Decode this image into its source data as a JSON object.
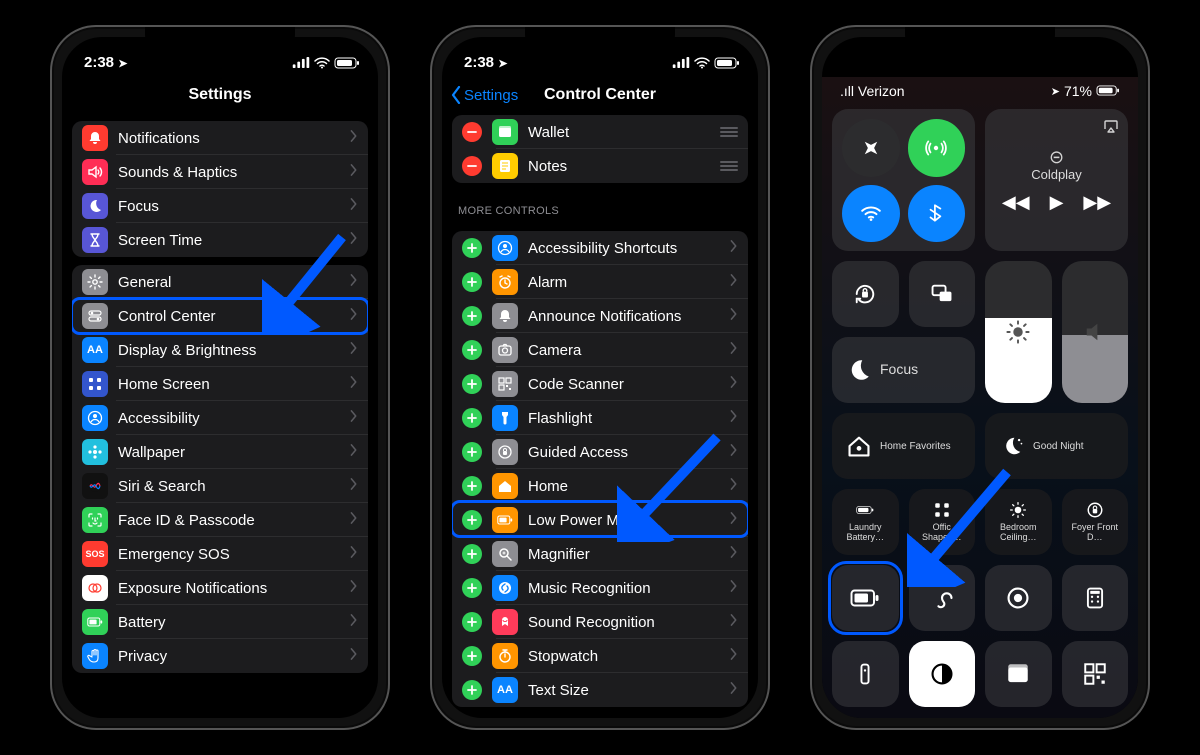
{
  "phone1": {
    "status": {
      "time": "2:38",
      "location_glyph": "➤"
    },
    "nav_title": "Settings",
    "group_a": [
      {
        "label": "Notifications",
        "icon": "bell",
        "bg": "#ff3b30"
      },
      {
        "label": "Sounds & Haptics",
        "icon": "speaker",
        "bg": "#ff2d55"
      },
      {
        "label": "Focus",
        "icon": "moon",
        "bg": "#5856d6"
      },
      {
        "label": "Screen Time",
        "icon": "hourglass",
        "bg": "#5856d6"
      }
    ],
    "group_b": [
      {
        "label": "General",
        "icon": "gear",
        "bg": "#8e8e93"
      },
      {
        "label": "Control Center",
        "icon": "switches",
        "bg": "#8e8e93"
      },
      {
        "label": "Display & Brightness",
        "icon": "AA",
        "bg": "#0a84ff"
      },
      {
        "label": "Home Screen",
        "icon": "grid",
        "bg": "#3355cc"
      },
      {
        "label": "Accessibility",
        "icon": "person",
        "bg": "#0a84ff"
      },
      {
        "label": "Wallpaper",
        "icon": "flower",
        "bg": "#22c0de"
      },
      {
        "label": "Siri & Search",
        "icon": "siri",
        "bg": "#111"
      },
      {
        "label": "Face ID & Passcode",
        "icon": "faceid",
        "bg": "#30d158"
      },
      {
        "label": "Emergency SOS",
        "icon": "SOS",
        "bg": "#ff3b30"
      },
      {
        "label": "Exposure Notifications",
        "icon": "exposure",
        "bg": "#fff"
      },
      {
        "label": "Battery",
        "icon": "battery",
        "bg": "#30d158"
      },
      {
        "label": "Privacy",
        "icon": "hand",
        "bg": "#0a84ff"
      }
    ]
  },
  "phone2": {
    "status": {
      "time": "2:38",
      "location_glyph": "➤"
    },
    "nav_back": "Settings",
    "nav_title": "Control Center",
    "included": [
      {
        "label": "Wallet",
        "icon": "wallet",
        "bg": "#30d158",
        "lead": "del"
      },
      {
        "label": "Notes",
        "icon": "notes",
        "bg": "#ffcc00",
        "lead": "del"
      }
    ],
    "more_header": "MORE CONTROLS",
    "more": [
      {
        "label": "Accessibility Shortcuts",
        "icon": "person",
        "bg": "#0a84ff"
      },
      {
        "label": "Alarm",
        "icon": "alarm",
        "bg": "#ff9500"
      },
      {
        "label": "Announce Notifications",
        "icon": "bell",
        "bg": "#8e8e93"
      },
      {
        "label": "Camera",
        "icon": "camera",
        "bg": "#8e8e93"
      },
      {
        "label": "Code Scanner",
        "icon": "qr",
        "bg": "#8e8e93"
      },
      {
        "label": "Flashlight",
        "icon": "flashlight",
        "bg": "#0a84ff"
      },
      {
        "label": "Guided Access",
        "icon": "lockring",
        "bg": "#8e8e93"
      },
      {
        "label": "Home",
        "icon": "home",
        "bg": "#ff9500"
      },
      {
        "label": "Low Power Mode",
        "icon": "battery",
        "bg": "#ff9500"
      },
      {
        "label": "Magnifier",
        "icon": "magnifier",
        "bg": "#8e8e93"
      },
      {
        "label": "Music Recognition",
        "icon": "shazam",
        "bg": "#0a84ff"
      },
      {
        "label": "Sound Recognition",
        "icon": "soundrec",
        "bg": "#ff3b5a"
      },
      {
        "label": "Stopwatch",
        "icon": "stopwatch",
        "bg": "#ff9500"
      },
      {
        "label": "Text Size",
        "icon": "AA",
        "bg": "#0a84ff"
      }
    ]
  },
  "phone3": {
    "status": {
      "carrier": ".ıll Verizon",
      "battery_pct": "71%",
      "location_glyph": "➤"
    },
    "media": {
      "title": "Coldplay",
      "device_glyph": "⊝"
    },
    "conn": {
      "airplane": false,
      "cellular": true,
      "wifi": true,
      "bluetooth": true
    },
    "focus_label": "Focus",
    "scenes": {
      "home": "Home Favorites",
      "goodnight": "Good Night"
    },
    "hk_tiles": [
      "Laundry Battery…",
      "Offic Shapes…",
      "Bedroom Ceiling…",
      "Foyer Front D…"
    ],
    "bottom_row2": [
      "remote",
      "darkmode",
      "wallet",
      "qr",
      "list"
    ]
  }
}
